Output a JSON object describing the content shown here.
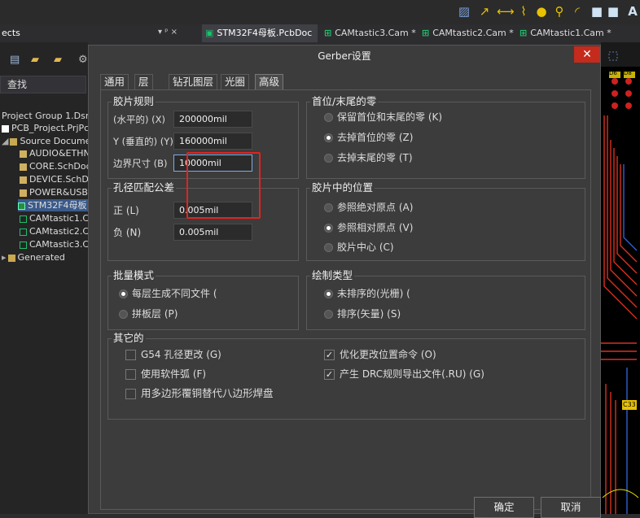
{
  "toolbar": {
    "icons": [
      "grid-hatch-icon",
      "route-icon",
      "wire-icon",
      "bus-icon",
      "pad-circle-icon",
      "via-icon",
      "arc-icon",
      "rectangle-icon",
      "text-icon"
    ],
    "text_glyph": "A"
  },
  "project_panel": {
    "title": "ects",
    "search_label": "查找",
    "items": [
      {
        "label": "Project Group 1.Dsn'",
        "level": 0
      },
      {
        "label": "PCB_Project.PrjPcb",
        "level": 0
      },
      {
        "label": "Source Documents",
        "level": 1
      },
      {
        "label": "AUDIO&ETHNET",
        "level": 2
      },
      {
        "label": "CORE.SchDoc",
        "level": 2
      },
      {
        "label": "DEVICE.SchDoc",
        "level": 2
      },
      {
        "label": "POWER&USB",
        "level": 2
      },
      {
        "label": "STM32F4母板",
        "level": 2
      },
      {
        "label": "CAMtastic1.Cam",
        "level": 2
      },
      {
        "label": "CAMtastic2.Cam",
        "level": 2
      },
      {
        "label": "CAMtastic3.Cam",
        "level": 2
      },
      {
        "label": "Generated",
        "level": 0
      }
    ],
    "pin_glyph": "▾ ᵖ ×"
  },
  "doc_tabs": [
    {
      "label": "STM32F4母板.PcbDoc",
      "active": true
    },
    {
      "label": "CAMtastic3.Cam *",
      "active": false
    },
    {
      "label": "CAMtastic2.Cam *",
      "active": false
    },
    {
      "label": "CAMtastic1.Cam *",
      "active": false
    }
  ],
  "pcb_labels": {
    "a": "D6",
    "b": "D8",
    "c": "C33"
  },
  "dialog": {
    "title": "Gerber设置",
    "close_glyph": "✕",
    "tabs": [
      "通用",
      "层",
      "钻孔图层",
      "光圈",
      "高级"
    ],
    "active_tab": "高级",
    "film_rules": {
      "title": "胶片规则",
      "x_label": "(水平的) (X)",
      "x_value": "200000mil",
      "y_label": "Y (垂直的) (Y)",
      "y_value": "160000mil",
      "border_label": "边界尺寸 (B)",
      "border_value": "10000mil"
    },
    "leading_zeros": {
      "title": "首位/末尾的零",
      "options": [
        "保留首位和末尾的零 (K)",
        "去掉首位的零 (Z)",
        "去掉末尾的零 (T)"
      ],
      "selected": 1
    },
    "hole_tolerance": {
      "title": "孔径匹配公差",
      "plus_label": "正 (L)",
      "plus_value": "0.005mil",
      "minus_label": "负 (N)",
      "minus_value": "0.005mil"
    },
    "film_position": {
      "title": "胶片中的位置",
      "options": [
        "参照绝对原点 (A)",
        "参照相对原点 (V)",
        "胶片中心 (C)"
      ],
      "selected": 1
    },
    "batch_mode": {
      "title": "批量模式",
      "options": [
        "每层生成不同文件 (",
        "拼板层 (P)"
      ],
      "selected": 0
    },
    "plot_type": {
      "title": "绘制类型",
      "options": [
        "未排序的(光栅) (",
        "排序(矢量) (S)"
      ],
      "selected": 0
    },
    "other": {
      "title": "其它的",
      "left": [
        {
          "label": "G54 孔径更改 (G)",
          "checked": false
        },
        {
          "label": "使用软件弧 (F)",
          "checked": false
        },
        {
          "label": "用多边形覆铜替代八边形焊盘",
          "checked": false
        }
      ],
      "right": [
        {
          "label": "优化更改位置命令 (O)",
          "checked": true
        },
        {
          "label": "产生 DRC规则导出文件(.RU) (G)",
          "checked": true
        }
      ]
    },
    "ok_label": "确定",
    "cancel_label": "取消"
  },
  "colors": {
    "highlight": "#e0241f",
    "close": "#c42b1c",
    "pcb_trace": "#d93020"
  }
}
